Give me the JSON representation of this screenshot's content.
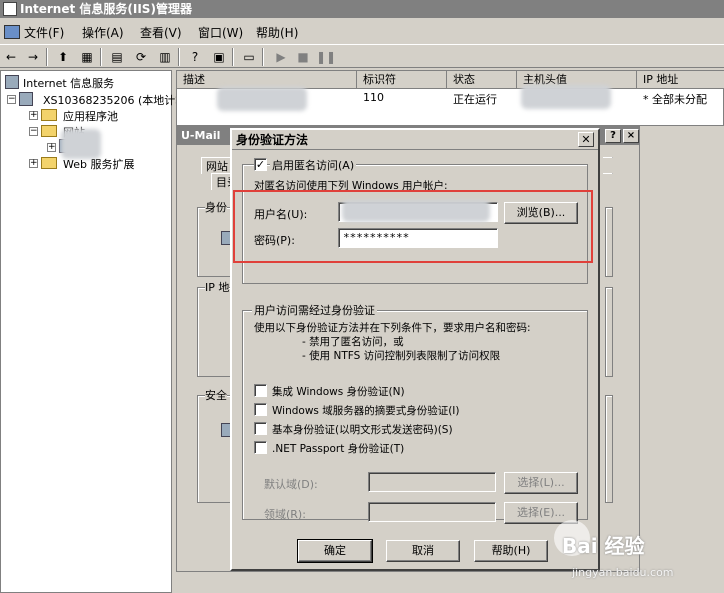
{
  "window": {
    "title": "Internet 信息服务(IIS)管理器"
  },
  "menu": [
    "文件(F)",
    "操作(A)",
    "查看(V)",
    "窗口(W)",
    "帮助(H)"
  ],
  "tree": {
    "root": "Internet 信息服务",
    "server": "XS10368235206 (本地计算",
    "app_pools": "应用程序池",
    "websites": "网站",
    "web_ext": "Web 服务扩展"
  },
  "list": {
    "headers": [
      "描述",
      "标识符",
      "状态",
      "主机头值",
      "IP 地址"
    ],
    "row": {
      "id": "110",
      "status": "正在运行",
      "ip": "* 全部未分配"
    }
  },
  "bg_dialog": {
    "title": "U-Mail",
    "tab1": "网站",
    "tab2": "目录",
    "group1": "身份",
    "group2": "IP 地",
    "group3": "安全"
  },
  "dialog": {
    "title": "身份验证方法",
    "anon_checkbox": "启用匿名访问(A)",
    "anon_desc": "对匿名访问使用下列 Windows 用户帐户:",
    "username_label": "用户名(U):",
    "browse_button": "浏览(B)...",
    "password_label": "密码(P):",
    "password_value": "**********",
    "auth_group_label": "用户访问需经过身份验证",
    "auth_desc1": "使用以下身份验证方法并在下列条件下，要求用户名和密码:",
    "auth_desc2": "- 禁用了匿名访问，或",
    "auth_desc3": "- 使用 NTFS 访问控制列表限制了访问权限",
    "opt1": "集成 Windows 身份验证(N)",
    "opt2": "Windows 域服务器的摘要式身份验证(I)",
    "opt3": "基本身份验证(以明文形式发送密码)(S)",
    "opt4": ".NET Passport 身份验证(T)",
    "default_domain_label": "默认域(D):",
    "realm_label": "领域(R):",
    "select_button1": "选择(L)...",
    "select_button2": "选择(E)...",
    "ok_button": "确定",
    "cancel_button": "取消",
    "help_button": "帮助(H)"
  },
  "watermark": {
    "brand": "Bai 经验",
    "url": "jingyan.baidu.com"
  },
  "highlight_color": "#e0403a"
}
